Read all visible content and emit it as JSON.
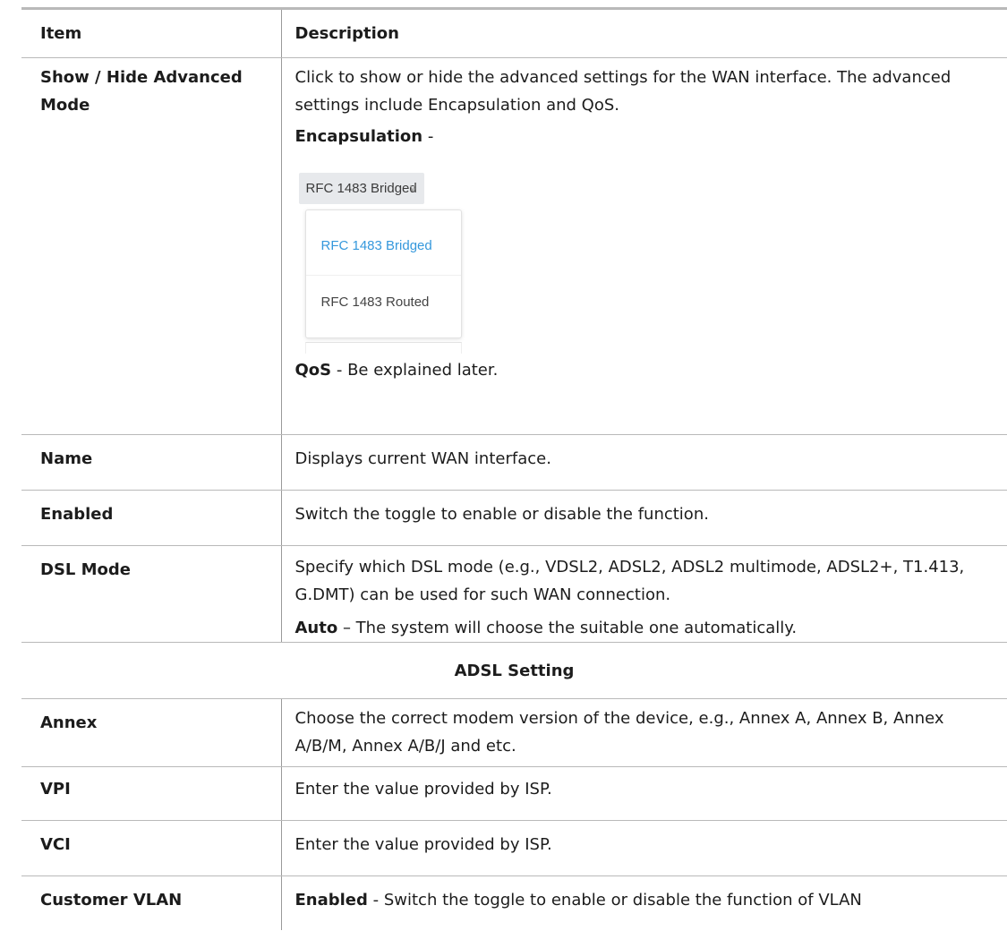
{
  "table": {
    "header": {
      "item": "Item",
      "description": "Description"
    },
    "show_hide": {
      "item": "Show / Hide Advanced Mode",
      "desc": "Click to show or hide the advanced settings for the WAN interface. The advanced settings include Encapsulation and QoS.",
      "encap_label": "Encapsulation",
      "encap_sep": " -",
      "dropdown": {
        "selected": "RFC 1483 Bridged",
        "options": [
          "RFC 1483 Bridged",
          "RFC 1483 Routed"
        ]
      },
      "qos_label": "QoS",
      "qos_text": " - Be explained later."
    },
    "name": {
      "item": "Name",
      "desc": "Displays current WAN interface."
    },
    "enabled": {
      "item": "Enabled",
      "desc": "Switch the toggle to enable or disable the function."
    },
    "dsl_mode": {
      "item": "DSL Mode",
      "desc": "Specify which DSL mode (e.g., VDSL2, ADSL2, ADSL2 multimode, ADSL2+, T1.413, G.DMT) can be used for such WAN connection.",
      "auto_label": "Auto",
      "auto_text": " – The system will choose the suitable one automatically."
    },
    "section_title": "ADSL Setting",
    "annex": {
      "item": "Annex",
      "desc": "Choose the correct modem version of the device, e.g., Annex A, Annex B, Annex A/B/M, Annex A/B/J and etc."
    },
    "vpi": {
      "item": "VPI",
      "desc": "Enter the value provided by ISP."
    },
    "vci": {
      "item": "VCI",
      "desc": "Enter the value provided by ISP."
    },
    "customer_vlan": {
      "item": "Customer VLAN",
      "enabled_label": "Enabled",
      "desc": " - Switch the toggle to enable or disable the function of VLAN"
    }
  },
  "colors": {
    "selected_option": "#3598dc",
    "border": "#b9b9b9"
  }
}
